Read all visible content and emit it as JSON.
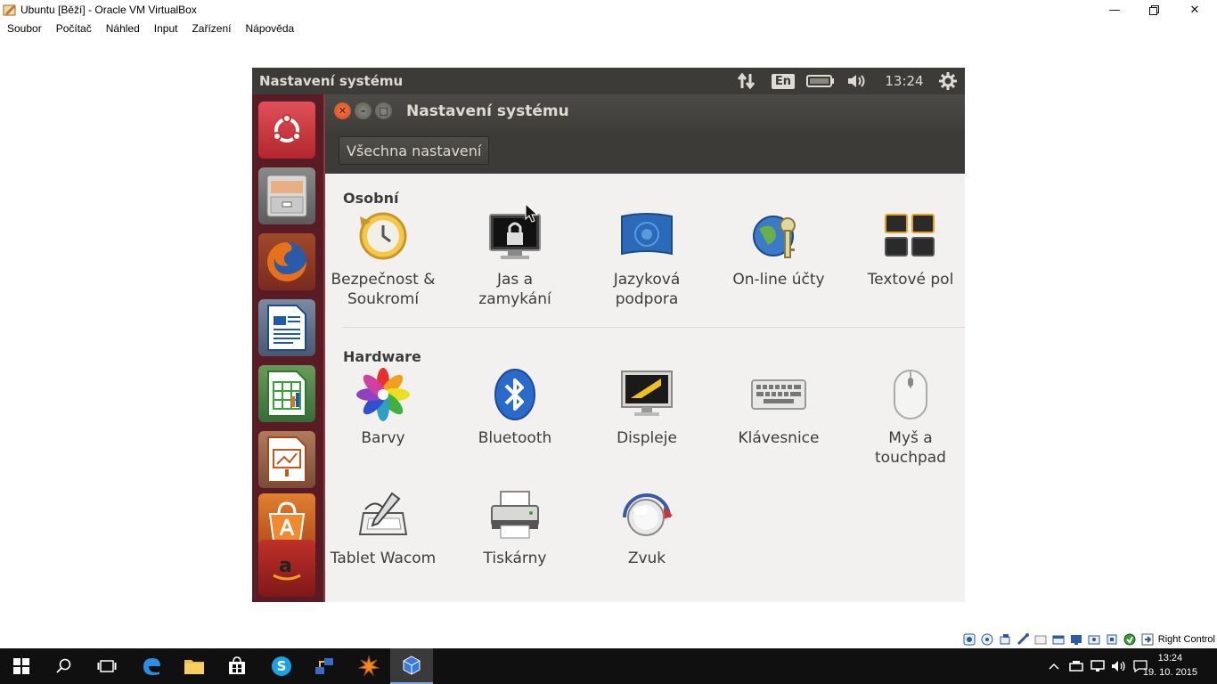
{
  "host": {
    "window_title": "Ubuntu [Běží] - Oracle VM VirtualBox",
    "menu": [
      "Soubor",
      "Počítač",
      "Náhled",
      "Input",
      "Zařízení",
      "Nápověda"
    ],
    "host_key": "Right Control"
  },
  "ubuntu": {
    "panel_title": "Nastavení systému",
    "keyboard_layout": "En",
    "clock": "13:24",
    "window_title": "Nastavení systému",
    "all_settings_button": "Všechna nastavení",
    "sections": {
      "personal": {
        "title": "Osobní",
        "items": [
          "Bezpečnost &\nSoukromí",
          "Jas a\nzamykání",
          "Jazyková\npodpora",
          "On-line účty",
          "Textové pol"
        ]
      },
      "hardware": {
        "title": "Hardware",
        "items": [
          "Barvy",
          "Bluetooth",
          "Displeje",
          "Klávesnice",
          "Myš a\ntouchpad",
          "Tablet Wacom",
          "Tiskárny",
          "Zvuk"
        ]
      }
    },
    "launcher_icons": [
      "ubuntu-dash-icon",
      "files-icon",
      "firefox-icon",
      "writer-icon",
      "calc-icon",
      "impress-icon",
      "software-center-icon",
      "amazon-icon"
    ]
  },
  "taskbar": {
    "time": "13:24",
    "date": "19. 10. 2015"
  },
  "colors": {
    "ubuntu_panel": "#3c3b37",
    "launcher": "#5a1c24",
    "ubuntu_orange": "#dd4814",
    "taskbar": "#101010"
  }
}
